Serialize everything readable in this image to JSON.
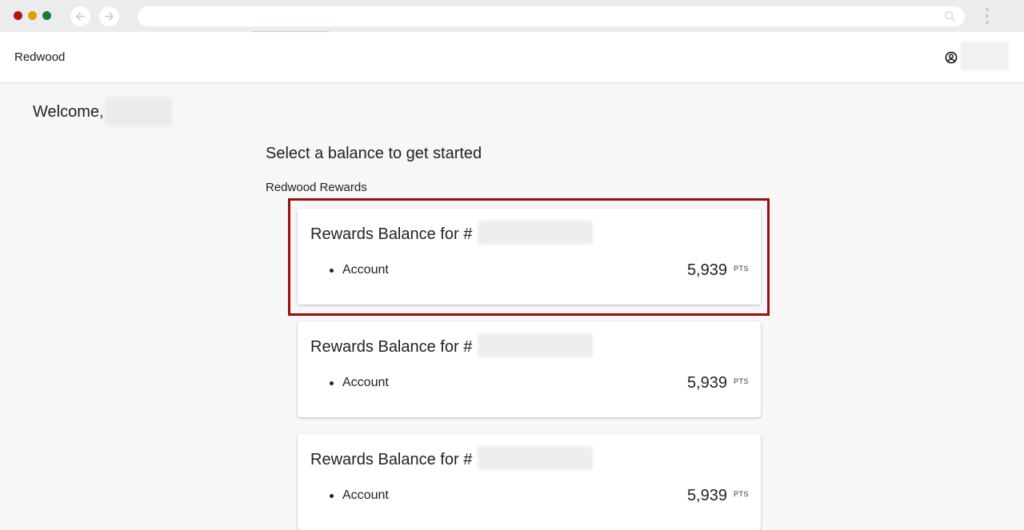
{
  "browser": {
    "back_icon": "arrow-left-icon",
    "forward_icon": "arrow-right-icon",
    "address_value": "",
    "search_icon": "search-icon",
    "menu_icon": "kebab-menu-icon",
    "window_dot_colors": [
      "#b01414",
      "#d9a400",
      "#177a3c"
    ]
  },
  "header": {
    "brand": "Redwood",
    "user_icon": "user-circle-icon"
  },
  "welcome": {
    "label": "Welcome,"
  },
  "main": {
    "title": "Select a balance to get started",
    "group_label": "Redwood Rewards",
    "cards": [
      {
        "title": "Rewards Balance for #",
        "row_label": "Account",
        "points": "5,939",
        "unit": "PTS"
      },
      {
        "title": "Rewards Balance for #",
        "row_label": "Account",
        "points": "5,939",
        "unit": "PTS"
      },
      {
        "title": "Rewards Balance for #",
        "row_label": "Account",
        "points": "5,939",
        "unit": "PTS"
      }
    ]
  },
  "colors": {
    "highlight": "#9b0e0e",
    "page_bg": "#f7f7f7",
    "card_bg": "#ffffff"
  }
}
